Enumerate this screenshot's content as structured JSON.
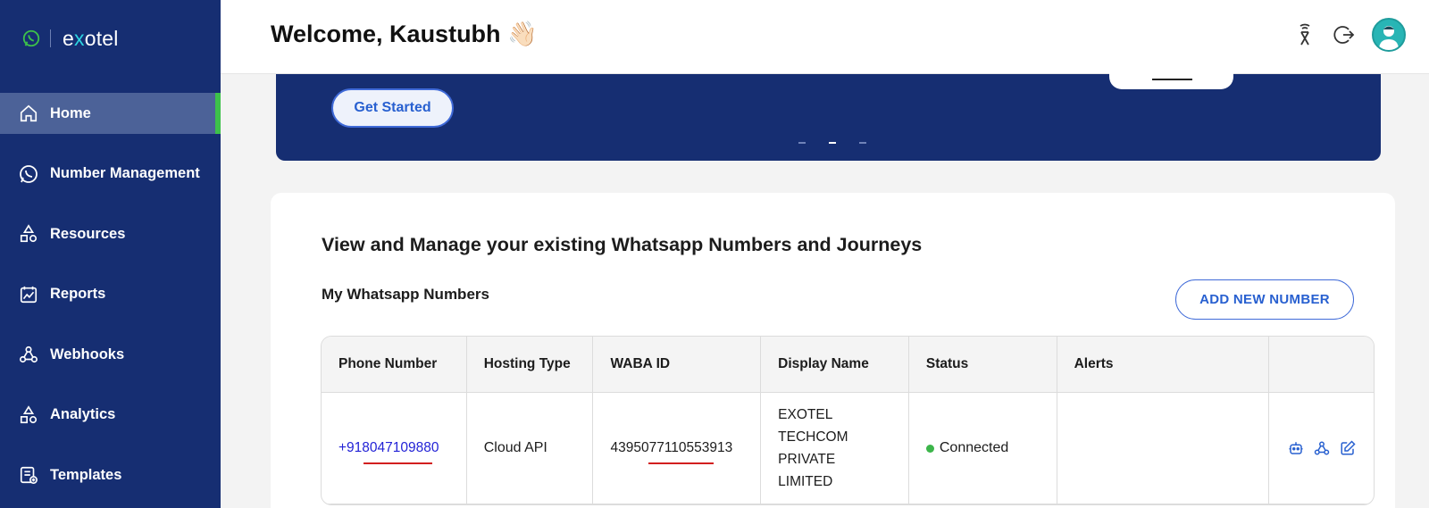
{
  "brand": {
    "logo_pre": "e",
    "logo_x": "x",
    "logo_post": "otel"
  },
  "sidebar": {
    "items": [
      {
        "label": "Home",
        "icon": "home-icon",
        "active": true
      },
      {
        "label": "Number Management",
        "icon": "whatsapp-icon",
        "active": false
      },
      {
        "label": "Resources",
        "icon": "shapes-icon",
        "active": false
      },
      {
        "label": "Reports",
        "icon": "chart-icon",
        "active": false
      },
      {
        "label": "Webhooks",
        "icon": "webhook-icon",
        "active": false
      },
      {
        "label": "Analytics",
        "icon": "shapes-icon",
        "active": false
      },
      {
        "label": "Templates",
        "icon": "template-icon",
        "active": false
      }
    ]
  },
  "header": {
    "welcome": "Welcome, Kaustubh 👋🏻"
  },
  "banner": {
    "cta": "Get Started"
  },
  "main": {
    "title": "View and Manage your existing Whatsapp Numbers and Journeys",
    "subtitle": "My Whatsapp Numbers",
    "add_button": "ADD NEW NUMBER",
    "table": {
      "columns": [
        "Phone Number",
        "Hosting Type",
        "WABA ID",
        "Display Name",
        "Status",
        "Alerts",
        ""
      ],
      "rows": [
        {
          "phone": "+918047109880",
          "hosting": "Cloud API",
          "waba_id": "4395077110553913",
          "display_name": [
            "EXOTEL",
            "TECHCOM",
            "PRIVATE",
            "LIMITED"
          ],
          "status": "Connected",
          "alerts": ""
        }
      ]
    }
  },
  "colors": {
    "sidebar": "#162e72",
    "accent": "#2860d0",
    "active_bar": "#3dc14a",
    "status_ok": "#3cb54a"
  }
}
